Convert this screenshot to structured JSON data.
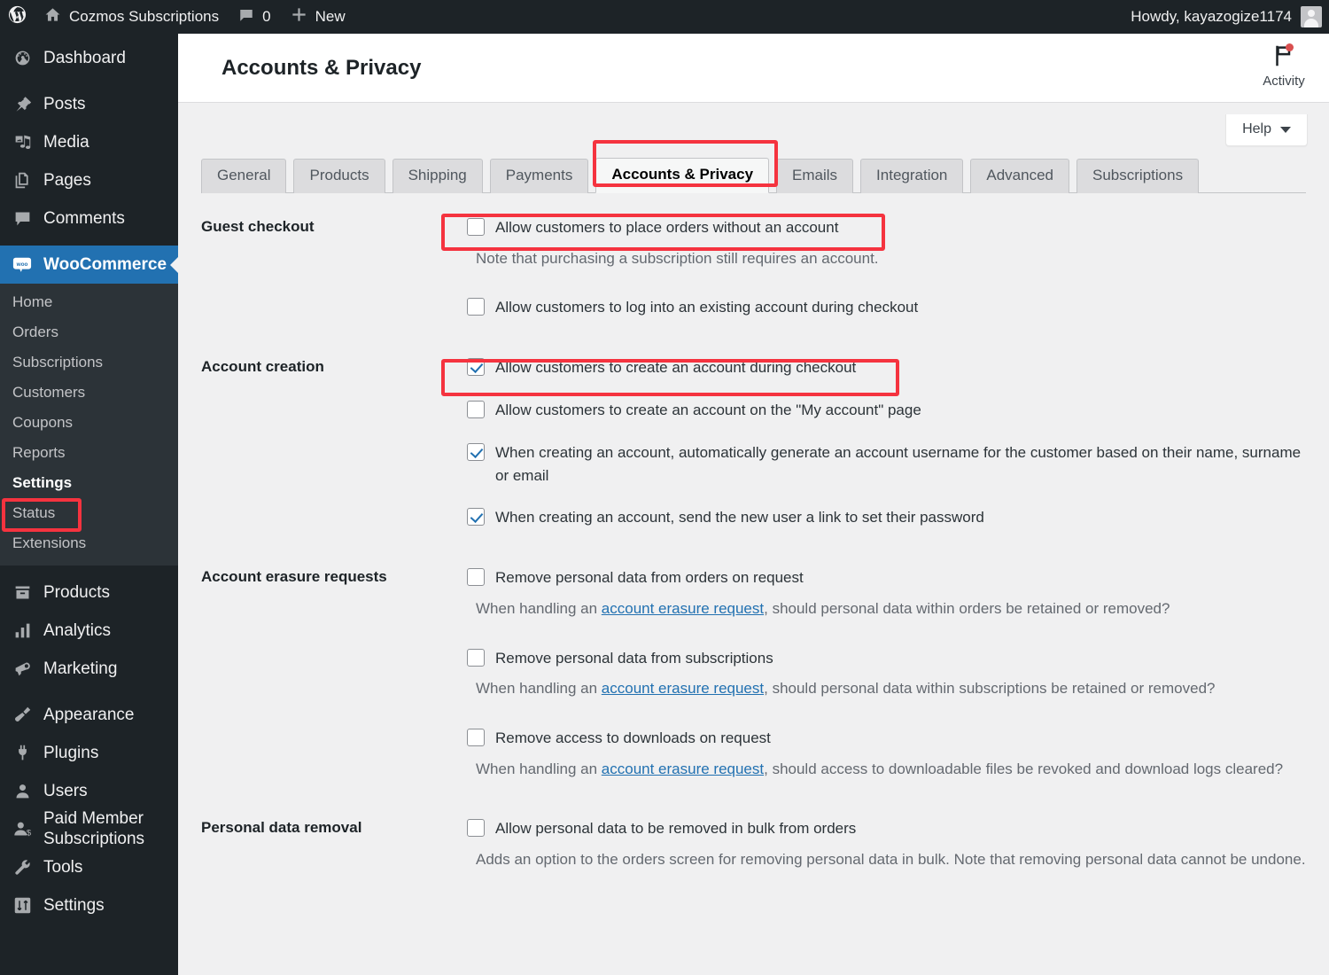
{
  "adminbar": {
    "logo_icon": "wordpress-icon",
    "site_icon": "home-icon",
    "site_name": "Cozmos Subscriptions",
    "comments_icon": "comment-bubble-icon",
    "comments_count": "0",
    "new_icon": "plus-icon",
    "new_label": "New",
    "greeting": "Howdy, kayazogize1174",
    "avatar_icon": "user-avatar"
  },
  "sidebar": {
    "items": [
      {
        "label": "Dashboard",
        "icon": "dashboard-icon",
        "current": false
      },
      {
        "label": "Posts",
        "icon": "pin-icon",
        "current": false
      },
      {
        "label": "Media",
        "icon": "media-icon",
        "current": false
      },
      {
        "label": "Pages",
        "icon": "pages-icon",
        "current": false
      },
      {
        "label": "Comments",
        "icon": "comment-icon",
        "current": false
      },
      {
        "label": "WooCommerce",
        "icon": "woocommerce-icon",
        "current": true
      },
      {
        "label": "Products",
        "icon": "products-box-icon",
        "current": false
      },
      {
        "label": "Analytics",
        "icon": "bar-chart-icon",
        "current": false
      },
      {
        "label": "Marketing",
        "icon": "megaphone-icon",
        "current": false
      },
      {
        "label": "Appearance",
        "icon": "paintbrush-icon",
        "current": false
      },
      {
        "label": "Plugins",
        "icon": "plug-icon",
        "current": false
      },
      {
        "label": "Users",
        "icon": "user-icon",
        "current": false
      },
      {
        "label": "Paid Member Subscriptions",
        "icon": "user-dollar-icon",
        "current": false
      },
      {
        "label": "Tools",
        "icon": "wrench-icon",
        "current": false
      },
      {
        "label": "Settings",
        "icon": "sliders-icon",
        "current": false
      }
    ],
    "woocommerce_submenu": [
      {
        "label": "Home",
        "current": false
      },
      {
        "label": "Orders",
        "current": false
      },
      {
        "label": "Subscriptions",
        "current": false
      },
      {
        "label": "Customers",
        "current": false
      },
      {
        "label": "Coupons",
        "current": false
      },
      {
        "label": "Reports",
        "current": false
      },
      {
        "label": "Settings",
        "current": true
      },
      {
        "label": "Status",
        "current": false
      },
      {
        "label": "Extensions",
        "current": false
      }
    ]
  },
  "header": {
    "title": "Accounts & Privacy",
    "activity_label": "Activity",
    "activity_icon": "flag-icon",
    "help_label": "Help",
    "help_caret_icon": "chevron-down-icon"
  },
  "tabs": [
    {
      "label": "General",
      "active": false
    },
    {
      "label": "Products",
      "active": false
    },
    {
      "label": "Shipping",
      "active": false
    },
    {
      "label": "Payments",
      "active": false
    },
    {
      "label": "Accounts & Privacy",
      "active": true
    },
    {
      "label": "Emails",
      "active": false
    },
    {
      "label": "Integration",
      "active": false
    },
    {
      "label": "Advanced",
      "active": false
    },
    {
      "label": "Subscriptions",
      "active": false
    }
  ],
  "sections": {
    "guest_checkout": {
      "label": "Guest checkout",
      "option1_label": "Allow customers to place orders without an account",
      "option1_checked": false,
      "option1_desc": "Note that purchasing a subscription still requires an account.",
      "option2_label": "Allow customers to log into an existing account during checkout",
      "option2_checked": false
    },
    "account_creation": {
      "label": "Account creation",
      "option1_label": "Allow customers to create an account during checkout",
      "option1_checked": true,
      "option2_label": "Allow customers to create an account on the \"My account\" page",
      "option2_checked": false,
      "option3_label": "When creating an account, automatically generate an account username for the customer based on their name, surname or email",
      "option3_checked": true,
      "option4_label": "When creating an account, send the new user a link to set their password",
      "option4_checked": true
    },
    "account_erasure": {
      "label": "Account erasure requests",
      "option1_label": "Remove personal data from orders on request",
      "option1_checked": false,
      "option1_desc_before": "When handling an ",
      "option1_desc_link": "account erasure request",
      "option1_desc_after": ", should personal data within orders be retained or removed?",
      "option2_label": "Remove personal data from subscriptions",
      "option2_checked": false,
      "option2_desc_before": "When handling an ",
      "option2_desc_link": "account erasure request",
      "option2_desc_after": ", should personal data within subscriptions be retained or removed?",
      "option3_label": "Remove access to downloads on request",
      "option3_checked": false,
      "option3_desc_before": "When handling an ",
      "option3_desc_link": "account erasure request",
      "option3_desc_after": ", should access to downloadable files be revoked and download logs cleared?"
    },
    "personal_data_removal": {
      "label": "Personal data removal",
      "option1_label": "Allow personal data to be removed in bulk from orders",
      "option1_checked": false,
      "option1_desc": "Adds an option to the orders screen for removing personal data in bulk. Note that removing personal data cannot be undone."
    }
  },
  "colors": {
    "highlight": "#f5333f",
    "accent": "#2271b1",
    "admin_bg": "#1d2327",
    "submenu_bg": "#2c3338",
    "content_bg": "#f0f0f1"
  }
}
